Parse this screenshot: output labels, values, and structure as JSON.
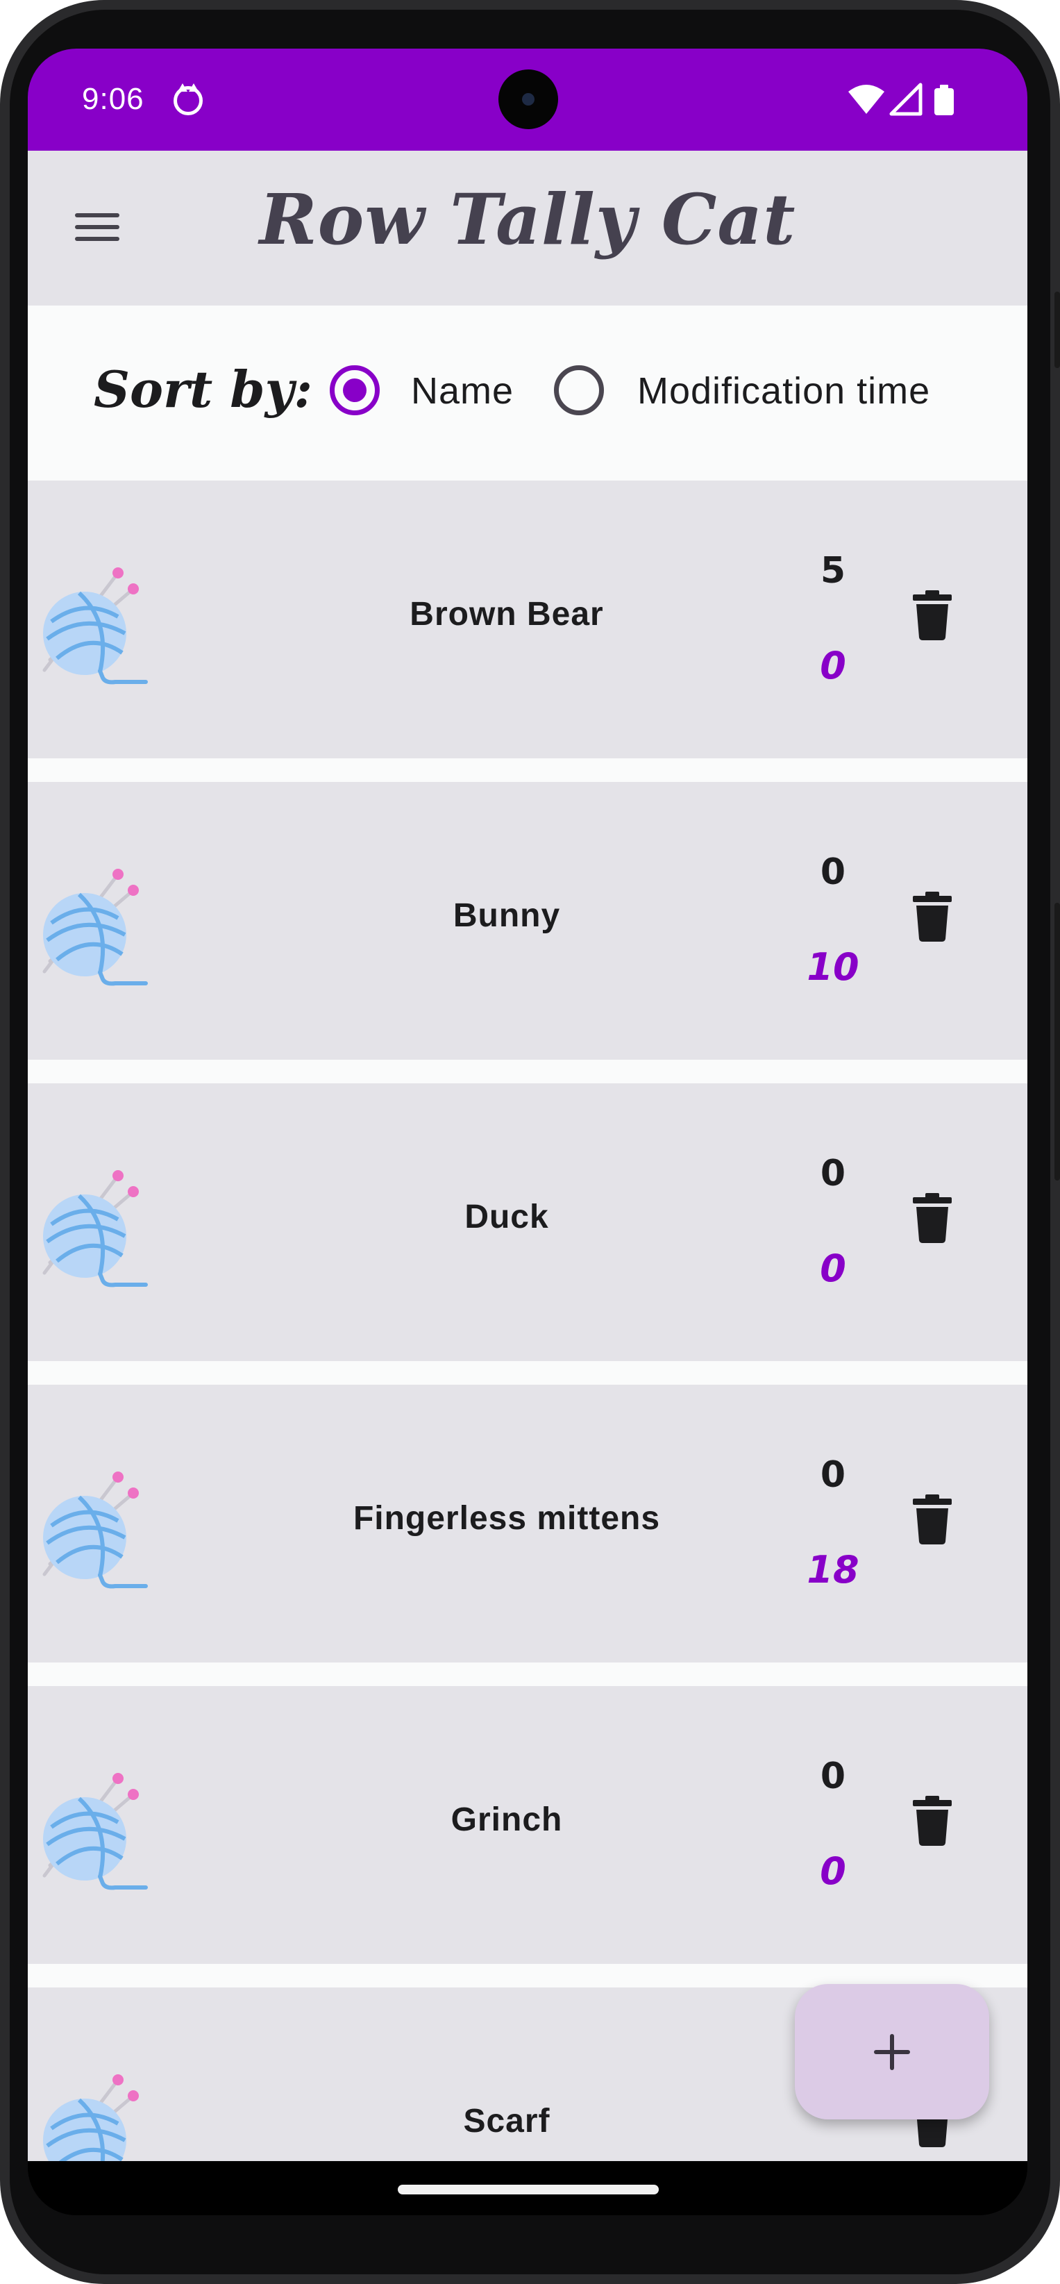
{
  "status_bar": {
    "time": "9:06",
    "icons": [
      "cat-notification-icon",
      "wifi-icon",
      "signal-icon",
      "battery-icon"
    ]
  },
  "app_bar": {
    "title": "Row Tally Cat",
    "menu_icon": "hamburger-menu-icon"
  },
  "sort": {
    "label": "Sort by:",
    "options": [
      {
        "label": "Name",
        "selected": true
      },
      {
        "label": "Modification time",
        "selected": false
      }
    ]
  },
  "projects": [
    {
      "name": "Brown Bear",
      "total_rows": "5",
      "current_row": "0"
    },
    {
      "name": "Bunny",
      "total_rows": "0",
      "current_row": "10"
    },
    {
      "name": "Duck",
      "total_rows": "0",
      "current_row": "0"
    },
    {
      "name": "Fingerless mittens",
      "total_rows": "0",
      "current_row": "18"
    },
    {
      "name": "Grinch",
      "total_rows": "0",
      "current_row": "0"
    },
    {
      "name": "Scarf",
      "total_rows": "",
      "current_row": ""
    }
  ],
  "fab": {
    "icon": "plus-icon"
  },
  "colors": {
    "accent": "#8800c8",
    "app_bar_bg": "#e4e3e8",
    "item_bg": "#e4e3e8",
    "fab_bg": "#dccbe6"
  }
}
